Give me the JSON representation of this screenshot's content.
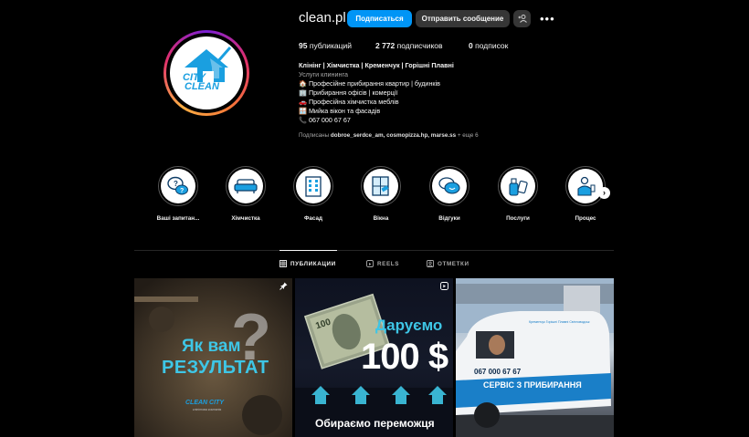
{
  "profile": {
    "username": "clean.pl",
    "follow_label": "Подписаться",
    "message_label": "Отправить сообщение",
    "add_label": "+👤",
    "more_label": "•••",
    "logo_line1": "CITY",
    "logo_line2": "CLEAN",
    "stats": {
      "posts_count": "95",
      "posts_label": "публикаций",
      "followers_count": "2 772",
      "followers_label": "подписчиков",
      "following_count": "0",
      "following_label": "подписок"
    },
    "bio": {
      "name": "Клінінг | Хімчистка | Кременчук | Горішні Плавні",
      "category": "Услуги клининга",
      "line1": "🏠 Професійне прибирання квартир | будинків",
      "line2": "🏢 Прибирання офісів | комерції",
      "line3": "🚗 Професійна хімчистка меблів",
      "line4": "🪟 Мийка вікон та фасадів",
      "line5": "📞 067 000 67 67"
    },
    "followed_by_prefix": "Подписаны",
    "followed_by_names": "dobroe_serdce_am, cosmopizza.hp, marse.ss",
    "followed_by_more": "+ еще 6"
  },
  "highlights": [
    {
      "label": "Ваші запитан...",
      "icon": "question-bubbles-icon"
    },
    {
      "label": "Хімчистка",
      "icon": "sofa-icon"
    },
    {
      "label": "Фасад",
      "icon": "building-icon"
    },
    {
      "label": "Вікна",
      "icon": "window-cleaning-icon"
    },
    {
      "label": "Відгуки",
      "icon": "reviews-icon"
    },
    {
      "label": "Послуги",
      "icon": "cleaning-spray-icon"
    },
    {
      "label": "Процес",
      "icon": "cleaner-person-icon"
    }
  ],
  "tabs": {
    "posts": "ПУБЛИКАЦИИ",
    "reels": "REELS",
    "tagged": "ОТМЕТКИ"
  },
  "posts": {
    "post1": {
      "line1": "Як вам",
      "line2": "РЕЗУЛЬТАТ",
      "qmark": "?",
      "brand": "CLEAN CITY",
      "brand_sub": "клінінгова компанія"
    },
    "post2": {
      "title": "Даруємо",
      "amount": "100 $",
      "caption": "Обираємо переможця",
      "banknote": "100"
    },
    "post3": {
      "phone": "067 000 67 67",
      "service": "СЕРВІС З ПРИБИРАННЯ",
      "cities": "Кременчук  Горішні Плавні  Світловодськ"
    }
  },
  "colors": {
    "accent": "#0095f6",
    "button_dark": "#363636",
    "brand_blue": "#1a9fe0",
    "teal_text": "#3ec6e6"
  }
}
